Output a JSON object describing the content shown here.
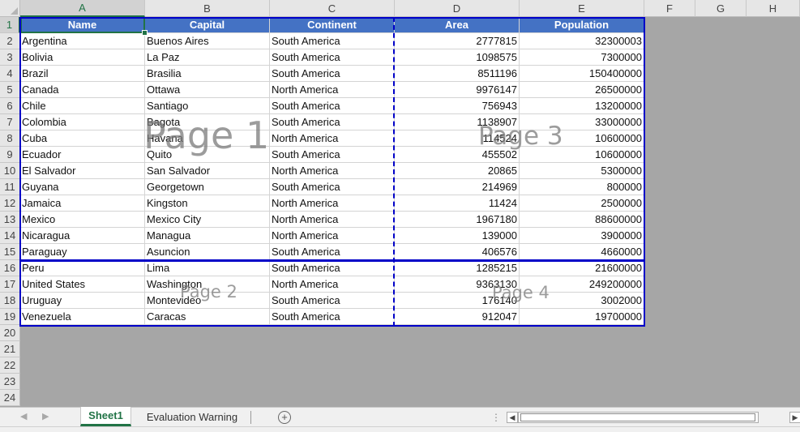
{
  "columns": [
    "A",
    "B",
    "C",
    "D",
    "E",
    "F",
    "G",
    "H"
  ],
  "rows": [
    "1",
    "2",
    "3",
    "4",
    "5",
    "6",
    "7",
    "8",
    "9",
    "10",
    "11",
    "12",
    "13",
    "14",
    "15",
    "16",
    "17",
    "18",
    "19",
    "20",
    "21",
    "22",
    "23",
    "24"
  ],
  "table": {
    "headers": [
      "Name",
      "Capital",
      "Continent",
      "Area",
      "Population"
    ],
    "rows": [
      [
        "Argentina",
        "Buenos Aires",
        "South America",
        "2777815",
        "32300003"
      ],
      [
        "Bolivia",
        "La Paz",
        "South America",
        "1098575",
        "7300000"
      ],
      [
        "Brazil",
        "Brasilia",
        "South America",
        "8511196",
        "150400000"
      ],
      [
        "Canada",
        "Ottawa",
        "North America",
        "9976147",
        "26500000"
      ],
      [
        "Chile",
        "Santiago",
        "South America",
        "756943",
        "13200000"
      ],
      [
        "Colombia",
        "Bagota",
        "South America",
        "1138907",
        "33000000"
      ],
      [
        "Cuba",
        "Havana",
        "North America",
        "114524",
        "10600000"
      ],
      [
        "Ecuador",
        "Quito",
        "South America",
        "455502",
        "10600000"
      ],
      [
        "El Salvador",
        "San Salvador",
        "North America",
        "20865",
        "5300000"
      ],
      [
        "Guyana",
        "Georgetown",
        "South America",
        "214969",
        "800000"
      ],
      [
        "Jamaica",
        "Kingston",
        "North America",
        "11424",
        "2500000"
      ],
      [
        "Mexico",
        "Mexico City",
        "North America",
        "1967180",
        "88600000"
      ],
      [
        "Nicaragua",
        "Managua",
        "North America",
        "139000",
        "3900000"
      ],
      [
        "Paraguay",
        "Asuncion",
        "South America",
        "406576",
        "4660000"
      ],
      [
        "Peru",
        "Lima",
        "South America",
        "1285215",
        "21600000"
      ],
      [
        "United States",
        "Washington",
        "North America",
        "9363130",
        "249200000"
      ],
      [
        "Uruguay",
        "Montevideo",
        "South America",
        "176140",
        "3002000"
      ],
      [
        "Venezuela",
        "Caracas",
        "South America",
        "912047",
        "19700000"
      ]
    ]
  },
  "page_watermarks": [
    "Page 1",
    "Page 3",
    "Page 2",
    "Page 4"
  ],
  "sheet_tabs": {
    "active": "Sheet1",
    "other": "Evaluation Warning"
  },
  "icons": {
    "add_sheet": "plus-circle-icon",
    "scroll_left": "caret-left-icon",
    "scroll_right": "caret-right-icon",
    "tab_prev": "tab-prev-icon",
    "tab_next": "tab-next-icon"
  },
  "colors": {
    "header_fill": "#4472c4",
    "accent": "#217346",
    "page_break": "#0000c8"
  }
}
